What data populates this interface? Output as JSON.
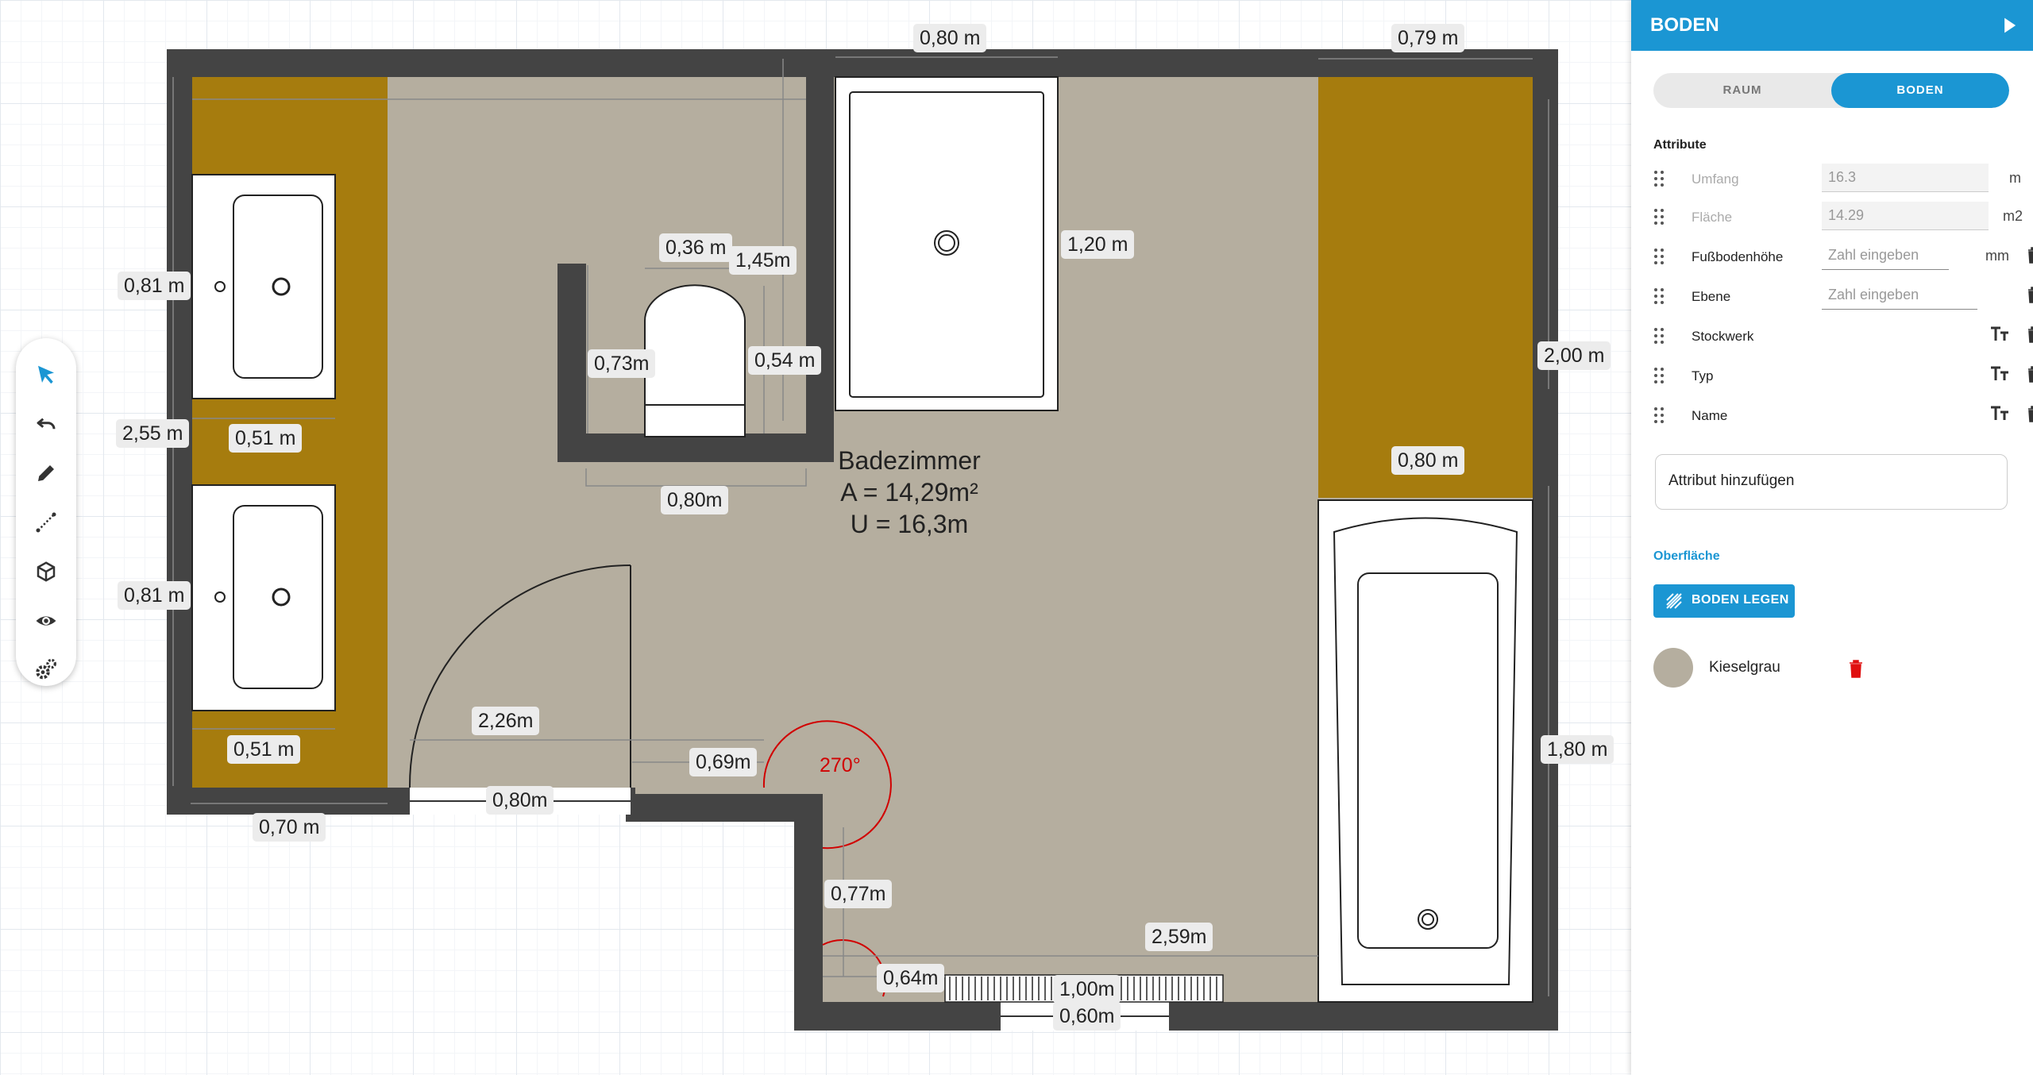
{
  "plan": {
    "room": {
      "name": "Badezimmer",
      "area": "A = 14,29m²",
      "perimeter": "U = 16,3m"
    },
    "angle": "270°",
    "dimensions": [
      {
        "key": "d_top_a",
        "text": "0,80 m"
      },
      {
        "key": "d_top_b",
        "text": "0,79 m"
      },
      {
        "key": "d_081_top",
        "text": "0,81 m"
      },
      {
        "key": "d_036",
        "text": "0,36 m"
      },
      {
        "key": "d_145",
        "text": "1,45m"
      },
      {
        "key": "d_120",
        "text": "1,20 m"
      },
      {
        "key": "d_200",
        "text": "2,00 m"
      },
      {
        "key": "d_073",
        "text": "0,73m"
      },
      {
        "key": "d_054",
        "text": "0,54 m"
      },
      {
        "key": "d_255",
        "text": "2,55 m"
      },
      {
        "key": "d_051_top",
        "text": "0,51 m"
      },
      {
        "key": "d_080_mid",
        "text": "0,80m"
      },
      {
        "key": "d_080_shelf",
        "text": "0,80 m"
      },
      {
        "key": "d_081_bot",
        "text": "0,81 m"
      },
      {
        "key": "d_226",
        "text": "2,26m"
      },
      {
        "key": "d_051_bot",
        "text": "0,51 m"
      },
      {
        "key": "d_069",
        "text": "0,69m"
      },
      {
        "key": "d_080_door",
        "text": "0,80m"
      },
      {
        "key": "d_070",
        "text": "0,70 m"
      },
      {
        "key": "d_180",
        "text": "1,80 m"
      },
      {
        "key": "d_077",
        "text": "0,77m"
      },
      {
        "key": "d_259",
        "text": "2,59m"
      },
      {
        "key": "d_064",
        "text": "0,64m"
      },
      {
        "key": "d_100",
        "text": "1,00m"
      },
      {
        "key": "d_060",
        "text": "0,60m"
      }
    ]
  },
  "toolbar": {
    "tools": [
      {
        "name": "select-tool",
        "icon": "arrow-cursor-icon",
        "active": true
      },
      {
        "name": "undo-tool",
        "icon": "undo-icon"
      },
      {
        "name": "draw-tool",
        "icon": "pencil-icon"
      },
      {
        "name": "measure-tool",
        "icon": "measure-line-icon"
      },
      {
        "name": "3d-view-tool",
        "icon": "cube-icon"
      },
      {
        "name": "visibility-tool",
        "icon": "eye-icon"
      },
      {
        "name": "settings-tool",
        "icon": "gears-icon"
      }
    ],
    "accent": "#1b96d3"
  },
  "panel": {
    "title": "BODEN",
    "tabs": [
      {
        "label": "RAUM",
        "active": false
      },
      {
        "label": "BODEN",
        "active": true
      }
    ],
    "attributes_title": "Attribute",
    "attributes": [
      {
        "name": "Umfang",
        "value": "16.3",
        "unit": "m",
        "disabled": true
      },
      {
        "name": "Fläche",
        "value": "14.29",
        "unit": "m2",
        "disabled": true
      },
      {
        "name": "Fußbodenhöhe",
        "placeholder": "Zahl eingeben",
        "unit": "mm"
      },
      {
        "name": "Ebene",
        "placeholder": "Zahl eingeben"
      },
      {
        "name": "Stockwerk"
      },
      {
        "name": "Typ"
      },
      {
        "name": "Name"
      }
    ],
    "add_attribute": "Attribut hinzufügen",
    "surface_title": "Oberfläche",
    "lay_floor_button": "BODEN LEGEN",
    "material": {
      "name": "Kieselgrau",
      "color": "#b5ae9f"
    }
  },
  "colors": {
    "wall": "#444444",
    "floor": "#b5ae9f",
    "cabinet": "#a67c0e",
    "header": "#1b96d3",
    "delete_red": "#d10000"
  }
}
